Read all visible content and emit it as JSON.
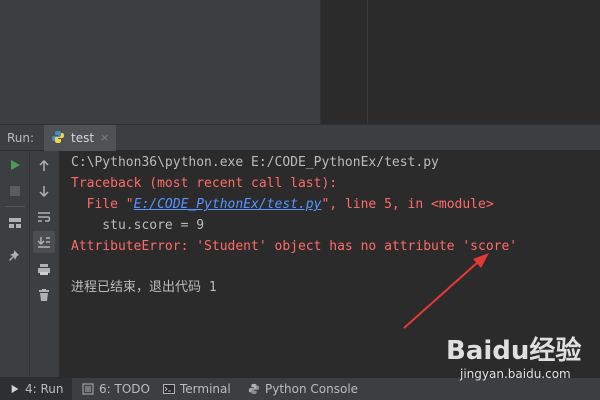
{
  "run_panel": {
    "label": "Run:",
    "tab": {
      "label": "test",
      "close": "×"
    }
  },
  "console": {
    "lines": {
      "command": "C:\\Python36\\python.exe E:/CODE_PythonEx/test.py",
      "traceback": "Traceback (most recent call last):",
      "file_prefix": "  File \"",
      "file_link": "E:/CODE_PythonEx/test.py",
      "file_suffix": "\", line 5, in <module>",
      "code": "    stu.score = 9",
      "error": "AttributeError: 'Student' object has no attribute 'score'",
      "exit": "进程已结束，退出代码 1"
    }
  },
  "bottom_tabs": [
    {
      "label": "4: Run",
      "icon": "play-icon"
    },
    {
      "label": "6: TODO",
      "icon": "todo-icon"
    },
    {
      "label": "Terminal",
      "icon": "terminal-icon"
    },
    {
      "label": "Python Console",
      "icon": "python-icon"
    }
  ],
  "watermark": {
    "brand": "Baidu经验",
    "url": "jingyan.baidu.com"
  },
  "colors": {
    "error_text": "#ff6b68",
    "link": "#5894ff",
    "normal_text": "#bbbbbb",
    "run_green": "#499c54",
    "annotation_arrow": "#e53935"
  }
}
